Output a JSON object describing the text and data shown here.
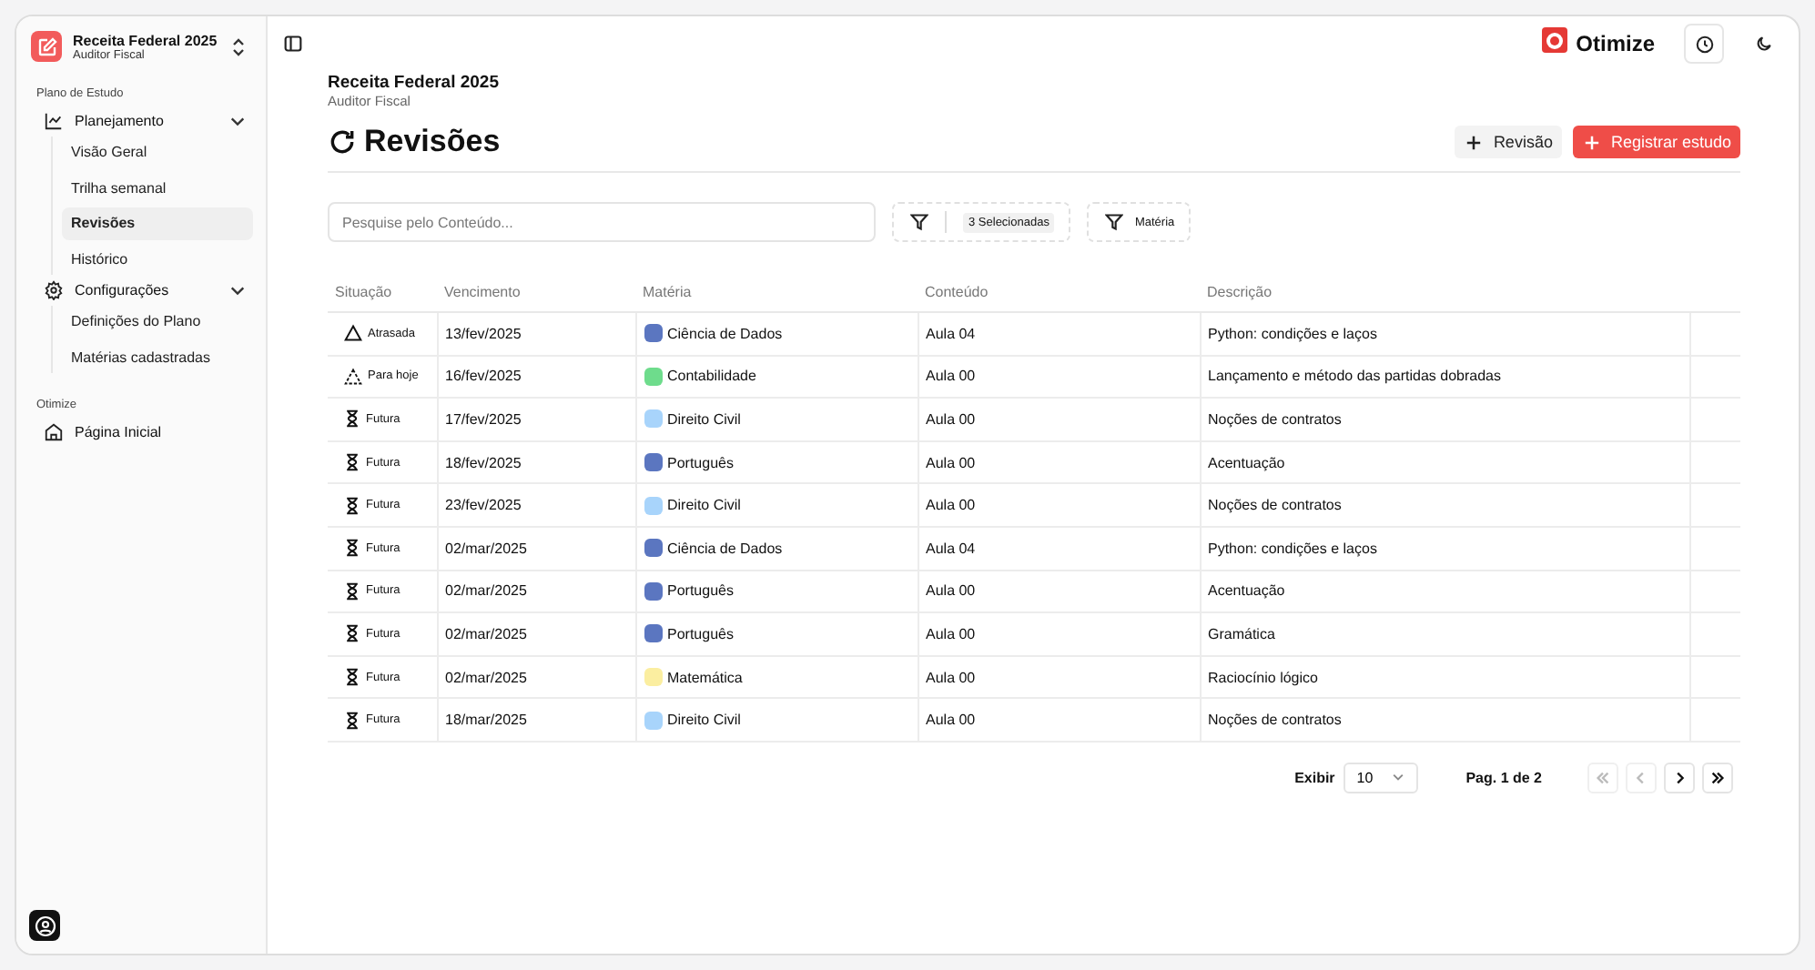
{
  "workspace": {
    "title": "Receita Federal 2025",
    "subtitle": "Auditor Fiscal"
  },
  "sidebar": {
    "groups": [
      {
        "label": "Plano de Estudo",
        "items": [
          {
            "label": "Planejamento",
            "expanded": true,
            "children": [
              {
                "label": "Visão Geral",
                "selected": false
              },
              {
                "label": "Trilha semanal",
                "selected": false
              },
              {
                "label": "Revisões",
                "selected": true
              },
              {
                "label": "Histórico",
                "selected": false
              }
            ]
          },
          {
            "label": "Configurações",
            "expanded": true,
            "children": [
              {
                "label": "Definições do Plano",
                "selected": false
              },
              {
                "label": "Matérias cadastradas",
                "selected": false
              }
            ]
          }
        ]
      },
      {
        "label": "Otimize",
        "items": [
          {
            "label": "Página Inicial"
          }
        ]
      }
    ]
  },
  "brand": "Otimize",
  "page": {
    "title": "Receita Federal 2025",
    "subtitle": "Auditor Fiscal",
    "heading": "Revisões"
  },
  "actions": [
    {
      "label": "Revisão",
      "kind": "secondary"
    },
    {
      "label": "Registrar estudo",
      "kind": "primary"
    }
  ],
  "search": {
    "placeholder": "Pesquise pelo Conteúdo..."
  },
  "filters": {
    "status_badge": "3 Selecionadas",
    "subject": "Matéria"
  },
  "table": {
    "columns": [
      "Situação",
      "Vencimento",
      "Matéria",
      "Conteúdo",
      "Descrição"
    ],
    "rows": [
      {
        "status": "Atrasada",
        "kind": "overdue",
        "date": "13/fev/2025",
        "subject": "Ciência de Dados",
        "color": "#5b76c0",
        "content": "Aula 04",
        "description": "Python: condições e laços"
      },
      {
        "status": "Para hoje",
        "kind": "today",
        "date": "16/fev/2025",
        "subject": "Contabilidade",
        "color": "#6edc8c",
        "content": "Aula 00",
        "description": "Lançamento e método das partidas dobradas"
      },
      {
        "status": "Futura",
        "kind": "future",
        "date": "17/fev/2025",
        "subject": "Direito Civil",
        "color": "#a8d4fb",
        "content": "Aula 00",
        "description": "Noções de contratos"
      },
      {
        "status": "Futura",
        "kind": "future",
        "date": "18/fev/2025",
        "subject": "Português",
        "color": "#5b76c0",
        "content": "Aula 00",
        "description": "Acentuação"
      },
      {
        "status": "Futura",
        "kind": "future",
        "date": "23/fev/2025",
        "subject": "Direito Civil",
        "color": "#a8d4fb",
        "content": "Aula 00",
        "description": "Noções de contratos"
      },
      {
        "status": "Futura",
        "kind": "future",
        "date": "02/mar/2025",
        "subject": "Ciência de Dados",
        "color": "#5b76c0",
        "content": "Aula 04",
        "description": "Python: condições e laços"
      },
      {
        "status": "Futura",
        "kind": "future",
        "date": "02/mar/2025",
        "subject": "Português",
        "color": "#5b76c0",
        "content": "Aula 00",
        "description": "Acentuação"
      },
      {
        "status": "Futura",
        "kind": "future",
        "date": "02/mar/2025",
        "subject": "Português",
        "color": "#5b76c0",
        "content": "Aula 00",
        "description": "Gramática"
      },
      {
        "status": "Futura",
        "kind": "future",
        "date": "02/mar/2025",
        "subject": "Matemática",
        "color": "#fbeea0",
        "content": "Aula 00",
        "description": "Raciocínio lógico"
      },
      {
        "status": "Futura",
        "kind": "future",
        "date": "18/mar/2025",
        "subject": "Direito Civil",
        "color": "#a8d4fb",
        "content": "Aula 00",
        "description": "Noções de contratos"
      }
    ]
  },
  "pagination": {
    "show_label": "Exibir",
    "page_size": "10",
    "page_info": "Pag. 1 de 2",
    "buttons": [
      {
        "kind": "first",
        "disabled": true
      },
      {
        "kind": "prev",
        "disabled": true
      },
      {
        "kind": "next",
        "disabled": false
      },
      {
        "kind": "last",
        "disabled": false
      }
    ]
  }
}
